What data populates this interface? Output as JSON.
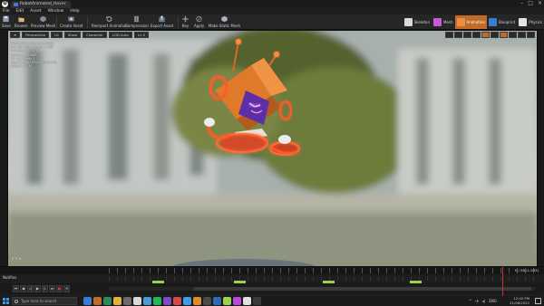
{
  "app": {
    "logo": "U",
    "window_tab": "RobotAnimated_Hover"
  },
  "menu": [
    "File",
    "Edit",
    "Asset",
    "Window",
    "Help"
  ],
  "toolbar": {
    "buttons": [
      {
        "label": "Save",
        "icon": "save-icon"
      },
      {
        "label": "Browse",
        "icon": "browse-icon"
      },
      {
        "label": "Preview Mesh",
        "icon": "preview-mesh-icon"
      },
      {
        "label": "Create Asset",
        "icon": "create-asset-icon"
      },
      {
        "label": "Reimport Animation",
        "icon": "reimport-icon"
      },
      {
        "label": "Compression",
        "icon": "compression-icon"
      },
      {
        "label": "Export Asset",
        "icon": "export-icon"
      },
      {
        "label": "Key",
        "icon": "key-icon"
      },
      {
        "label": "Apply",
        "icon": "apply-icon"
      },
      {
        "label": "Make Static Mesh",
        "icon": "static-mesh-icon"
      }
    ],
    "modes": [
      {
        "label": "Skeleton",
        "color": "#d9d9d9",
        "active": false
      },
      {
        "label": "Mesh",
        "color": "#c75bd6",
        "active": false
      },
      {
        "label": "Animation",
        "color": "#c26a2a",
        "active": true
      },
      {
        "label": "Blueprint",
        "color": "#3a7bd5",
        "active": false
      },
      {
        "label": "Physics",
        "color": "#e4e4e4",
        "active": false
      }
    ]
  },
  "viewport": {
    "chips": [
      "Perspective",
      "Lit",
      "Show",
      "Character",
      "LOD Auto",
      "x1.0"
    ],
    "stats": [
      "Previewing Reference Pose",
      "Current Screen Size: 1.433",
      "Triangles: 30,778",
      "Vertices: 16,668",
      "UV Channels: 1",
      "Approx Size: 638x697x1,276",
      "Aspect: 16:9"
    ],
    "axis_label": "z ↑ x"
  },
  "timeline": {
    "notifies_label": "Notifies",
    "frame_readout": "0 / 58 (1.933)",
    "transport": [
      "⏮",
      "◀",
      "◁",
      "▶",
      "▷",
      "⏭",
      "●",
      "⟲"
    ]
  },
  "taskbar": {
    "search_placeholder": "Type here to search",
    "tray_lang": "ENG",
    "time": "12:40 PM",
    "date": "21/06/2022",
    "apps": [
      "#3a7bd5",
      "#c26a2a",
      "#2d8a5a",
      "#e3b23c",
      "#6b6b6b",
      "#d9d9d9",
      "#4a9bd6",
      "#1db954",
      "#7a4bc2",
      "#d64a4a",
      "#3a9ee8",
      "#e08b2a",
      "#4a4a4a",
      "#2d6bb3",
      "#9bd24b",
      "#b84adb",
      "#e0e0e0",
      "#3a3a3a"
    ]
  },
  "colors": {
    "accent": "#c26a2a",
    "keyframe": "#9bd24b",
    "playhead": "#d43030"
  }
}
